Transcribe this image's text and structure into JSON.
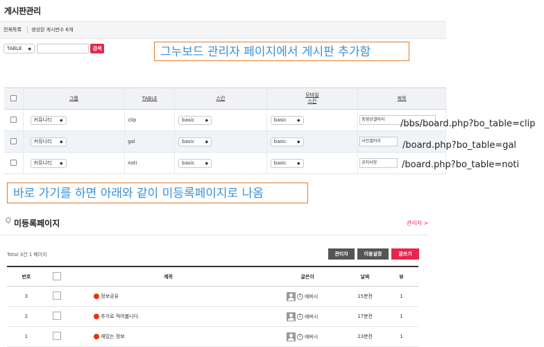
{
  "page_title": "게시판관리",
  "info": {
    "all_list": "전체목록",
    "count_text": "생성된 게시판수 6개"
  },
  "search": {
    "field_value": "TABLE",
    "input_value": "",
    "button_label": "검색"
  },
  "callout_top": "그누보드 관리자 페이지에서 게시판 추가함",
  "table": {
    "headers": [
      "그룹",
      "TABLE",
      "스킨",
      "모바일\n스킨",
      "제목"
    ],
    "rows": [
      {
        "group": "커뮤니티",
        "table": "clip",
        "skin": "basic",
        "mobile_skin": "basic",
        "title": "동영상갤러리"
      },
      {
        "group": "커뮤니티",
        "table": "gal",
        "skin": "basic",
        "mobile_skin": "basic",
        "title": "사진갤러리"
      },
      {
        "group": "커뮤니티",
        "table": "noti",
        "skin": "basic",
        "mobile_skin": "basic",
        "title": "공지사항"
      }
    ]
  },
  "urls": [
    "/bbs/board.php?bo_table=clip",
    "/board.php?bo_table=gal",
    "/board.php?bo_table=noti"
  ],
  "callout_bottom": "바로 가기를 하면 아래와 같이 미등록페이지로 나옴",
  "board": {
    "title": "미등록페이지",
    "admin_link": "관리자 >",
    "total": "Total 3건 1 페이지",
    "buttons": {
      "admin": "관리자",
      "usage": "이용설정",
      "write": "글쓰기"
    },
    "headers": {
      "num": "번호",
      "subject": "제목",
      "writer": "글쓴이",
      "date": "날짜",
      "views": "뷰"
    },
    "rows": [
      {
        "num": "3",
        "subject": "정보공유",
        "writer": "에버시",
        "date": "15분전",
        "views": "1"
      },
      {
        "num": "2",
        "subject": "추가로 적어봅니다.",
        "writer": "에버시",
        "date": "17분전",
        "views": "1"
      },
      {
        "num": "1",
        "subject": "재밌는 정보",
        "writer": "에버시",
        "date": "23분전",
        "views": "1"
      }
    ]
  },
  "colors": {
    "accent_red": "#e8264d",
    "callout_border": "#e07b2a",
    "callout_text": "#3b8fd6",
    "dark_btn": "#555555"
  }
}
